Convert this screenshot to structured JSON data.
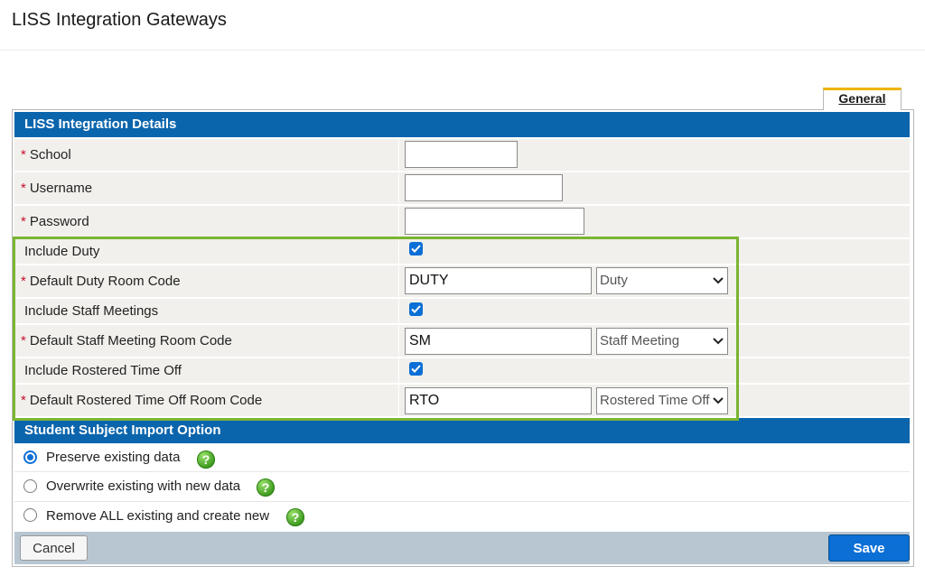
{
  "page": {
    "title": "LISS Integration Gateways"
  },
  "tabs": [
    {
      "label": "General",
      "active": true
    }
  ],
  "details": {
    "header": "LISS Integration Details",
    "school": {
      "label": "School",
      "value": ""
    },
    "username": {
      "label": "Username",
      "value": ""
    },
    "password": {
      "label": "Password",
      "value": ""
    },
    "include_duty": {
      "label": "Include Duty",
      "checked": true
    },
    "duty_room": {
      "label": "Default Duty Room Code",
      "value": "DUTY",
      "selected": "Duty"
    },
    "include_staff_meetings": {
      "label": "Include Staff Meetings",
      "checked": true
    },
    "staff_meeting_room": {
      "label": "Default Staff Meeting Room Code",
      "value": "SM",
      "selected": "Staff Meeting"
    },
    "include_rostered": {
      "label": "Include Rostered Time Off",
      "checked": true
    },
    "rostered_room": {
      "label": "Default Rostered Time Off Room Code",
      "value": "RTO",
      "selected": "Rostered Time Off"
    }
  },
  "import_option": {
    "header": "Student Subject Import Option",
    "options": [
      {
        "label": "Preserve existing data",
        "checked": true
      },
      {
        "label": "Overwrite existing with new data",
        "checked": false
      },
      {
        "label": "Remove ALL existing and create new",
        "checked": false
      }
    ]
  },
  "footer": {
    "cancel_label": "Cancel",
    "save_label": "Save"
  },
  "icons": {
    "help": "help-icon",
    "check": "check-icon",
    "dropdown": "chevron-down-icon"
  },
  "colors": {
    "header_blue": "#0b65ad",
    "highlight_green": "#7ab531",
    "tab_accent": "#f0b400",
    "save_blue": "#0b6fd6",
    "required_red": "#c8102e"
  }
}
